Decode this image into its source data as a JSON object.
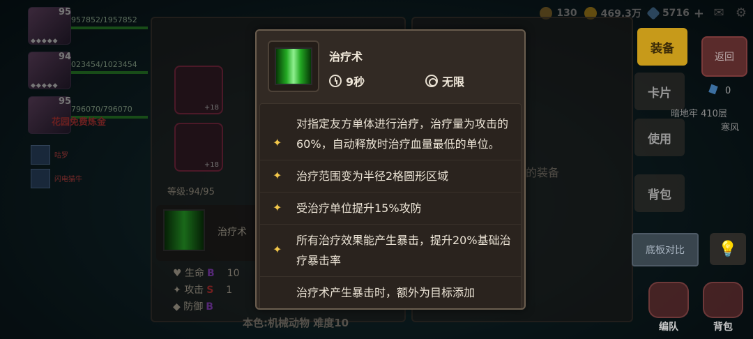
{
  "resources": {
    "bag_count": "130",
    "gold": "469.3万",
    "gems": "5716"
  },
  "party": [
    {
      "level": "95",
      "hp": "957852/1957852"
    },
    {
      "level": "94",
      "hp": "023454/1023454"
    },
    {
      "level": "95",
      "hp": "796070/796070"
    }
  ],
  "promo_text": "花园免费炼金",
  "small_members": [
    "咕罗",
    "闪电猫牛"
  ],
  "char_panel": {
    "slot_bonus": [
      "+18",
      "+18"
    ],
    "level_text": "等级:94/95",
    "skill_name": "治疗术",
    "stats": [
      {
        "label": "生命",
        "grade": "B",
        "value": "10"
      },
      {
        "label": "攻击",
        "grade": "S",
        "value": "1"
      },
      {
        "label": "防御",
        "grade": "B",
        "value": ""
      }
    ]
  },
  "stage_text": "本色:机械动物 难度10",
  "info_panel_hint": "的装备",
  "side_buttons": {
    "equip": "装备",
    "card": "卡片",
    "use": "使用",
    "backpack": "背包"
  },
  "back_label": "返回",
  "gem_small_count": "0",
  "dungeon_text": "暗地牢 410层",
  "weather_text": "寒风",
  "compare_label": "底板对比",
  "bottom_buttons": {
    "team": "编队",
    "bag": "背包"
  },
  "tooltip": {
    "title": "治疗术",
    "cooldown": "9秒",
    "range": "无限",
    "effects": [
      "对指定友方单体进行治疗，治疗量为攻击的60%，自动释放时治疗血量最低的单位。",
      "治疗范围变为半径2格圆形区域",
      "受治疗单位提升15%攻防",
      "所有治疗效果能产生暴击，提升20%基础治疗暴击率",
      "治疗术产生暴击时，额外为目标添加"
    ]
  },
  "colors": {
    "accent_gold": "#c79a1a",
    "star": "#f3c74a",
    "grade_b": "#9b4ad8",
    "grade_s": "#d43a3a"
  }
}
